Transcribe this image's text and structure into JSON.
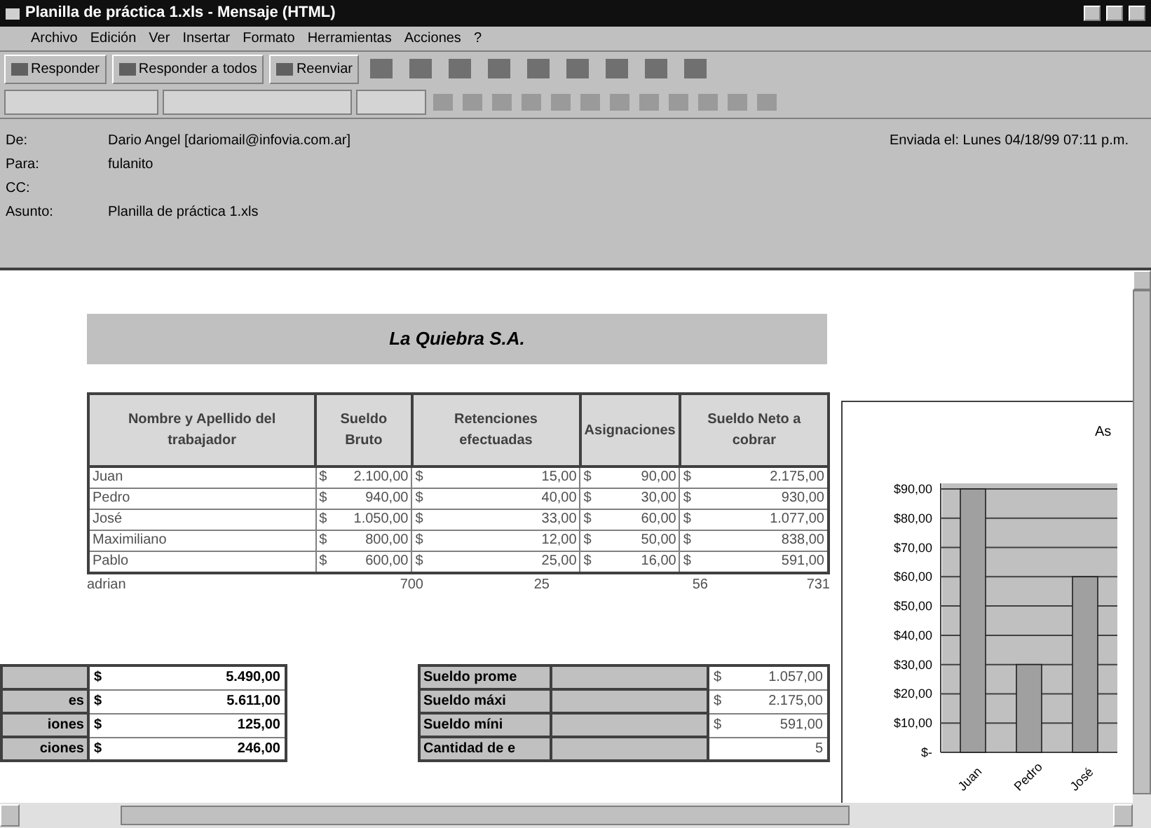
{
  "window": {
    "title": "Planilla de práctica 1.xls - Mensaje (HTML)"
  },
  "menu": [
    "Archivo",
    "Edición",
    "Ver",
    "Insertar",
    "Formato",
    "Herramientas",
    "Acciones",
    "?"
  ],
  "toolbar": [
    {
      "kind": "text",
      "label": "Responder"
    },
    {
      "kind": "text",
      "label": "Responder a todos"
    },
    {
      "kind": "text",
      "label": "Reenviar"
    }
  ],
  "header": [
    {
      "label": "De:",
      "value": "Dario Angel [dariomail@infovia.com.ar]"
    },
    {
      "label": "Para:",
      "value": "fulanito"
    },
    {
      "label": "CC:"
    },
    {
      "label": "Asunto:",
      "value": "Planilla de práctica 1.xls"
    }
  ],
  "sent": "Enviada el: Lunes 04/18/99 07:11 p.m.",
  "sheet": {
    "title": "La Quiebra S.A.",
    "columns": [
      "Nombre y Apellido del trabajador",
      "Sueldo Bruto",
      "Retenciones efectuadas",
      "Asignaciones",
      "Sueldo Neto a cobrar"
    ],
    "currency": "$",
    "rows": [
      [
        "Juan",
        "2.100,00",
        "15,00",
        "90,00",
        "2.175,00"
      ],
      [
        "Pedro",
        "940,00",
        "40,00",
        "30,00",
        "930,00"
      ],
      [
        "José",
        "1.050,00",
        "33,00",
        "60,00",
        "1.077,00"
      ],
      [
        "Maximiliano",
        "800,00",
        "12,00",
        "50,00",
        "838,00"
      ],
      [
        "Pablo",
        "600,00",
        "25,00",
        "16,00",
        "591,00"
      ]
    ],
    "extra_row": [
      "adrian",
      "700",
      "25",
      "56",
      "731"
    ],
    "totals": [
      {
        "value": "5.490,00"
      },
      {
        "label": "es",
        "value": "5.611,00"
      },
      {
        "label": "iones",
        "value": "125,00"
      },
      {
        "label": "ciones",
        "value": "246,00"
      }
    ],
    "stats": [
      {
        "label": "Sueldo prome",
        "currency": "$",
        "value": "1.057,00"
      },
      {
        "label": "Sueldo máxi",
        "currency": "$",
        "value": "2.175,00"
      },
      {
        "label": "Sueldo míni",
        "currency": "$",
        "value": "591,00"
      },
      {
        "label": "Cantidad de e",
        "value": "5"
      }
    ]
  },
  "chart": {
    "chart_data": {
      "type": "bar",
      "title": "As",
      "grid": true,
      "categories": [
        "Juan",
        "Pedro",
        "José"
      ],
      "values": [
        90,
        30,
        60
      ],
      "ylim": [
        0,
        90
      ],
      "yticks": [
        {
          "value": 0,
          "label": "$-"
        },
        {
          "value": 10,
          "label": "$10,00"
        },
        {
          "value": 20,
          "label": "$20,00"
        },
        {
          "value": 30,
          "label": "$30,00"
        },
        {
          "value": 40,
          "label": "$40,00"
        },
        {
          "value": 50,
          "label": "$50,00"
        },
        {
          "value": 60,
          "label": "$60,00"
        },
        {
          "value": 70,
          "label": "$70,00"
        },
        {
          "value": 80,
          "label": "$80,00"
        },
        {
          "value": 90,
          "label": "$90,00"
        }
      ]
    }
  }
}
